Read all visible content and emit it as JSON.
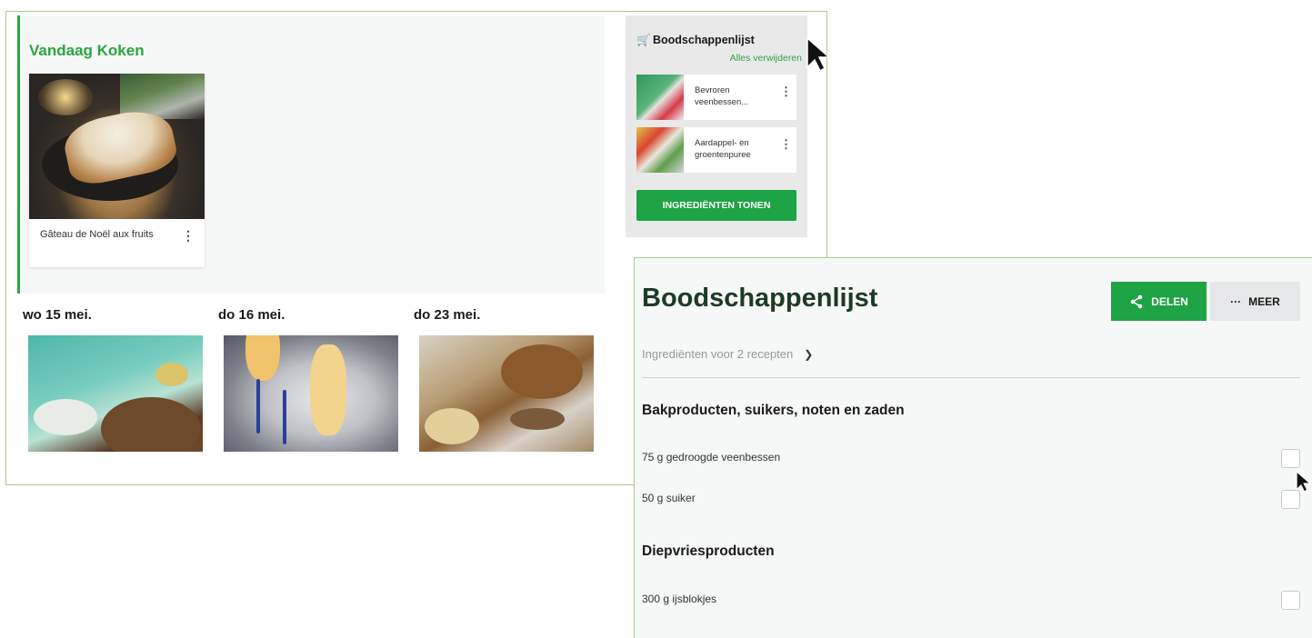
{
  "today": {
    "title": "Vandaag Koken",
    "recipe": {
      "name": "Gâteau de Noël aux fruits"
    }
  },
  "days": [
    {
      "label": "wo 15 mei."
    },
    {
      "label": "do 16 mei."
    },
    {
      "label": "do 23 mei."
    }
  ],
  "shopping_panel": {
    "title": "Boodschappenlijst",
    "clear_all": "Alles verwijderen",
    "items": [
      {
        "name": "Bevroren veenbessen..."
      },
      {
        "name": "Aardappel- en groentenpuree"
      }
    ],
    "show_ingredients": "INGREDIËNTEN TONEN"
  },
  "shopping_list": {
    "title": "Boodschappenlijst",
    "share_label": "DELEN",
    "more_label": "MEER",
    "recipes_summary": "Ingrediënten voor 2 recepten",
    "sections": [
      {
        "title": "Bakproducten, suikers, noten en zaden",
        "items": [
          "75 g gedroogde veenbessen",
          "50 g suiker"
        ]
      },
      {
        "title": "Diepvriesproducten",
        "items": [
          "300 g ijsblokjes"
        ]
      }
    ]
  },
  "colors": {
    "accent": "#2ba640",
    "button_green": "#1ea345",
    "title_dark_green": "#1d3b24",
    "panel_grey": "#e9e9e9",
    "background": "#f6f7f7"
  },
  "icons": [
    "cart-icon",
    "more-vertical-icon",
    "share-icon",
    "more-horizontal-icon",
    "chevron-down-icon",
    "cursor-arrow-icon"
  ]
}
